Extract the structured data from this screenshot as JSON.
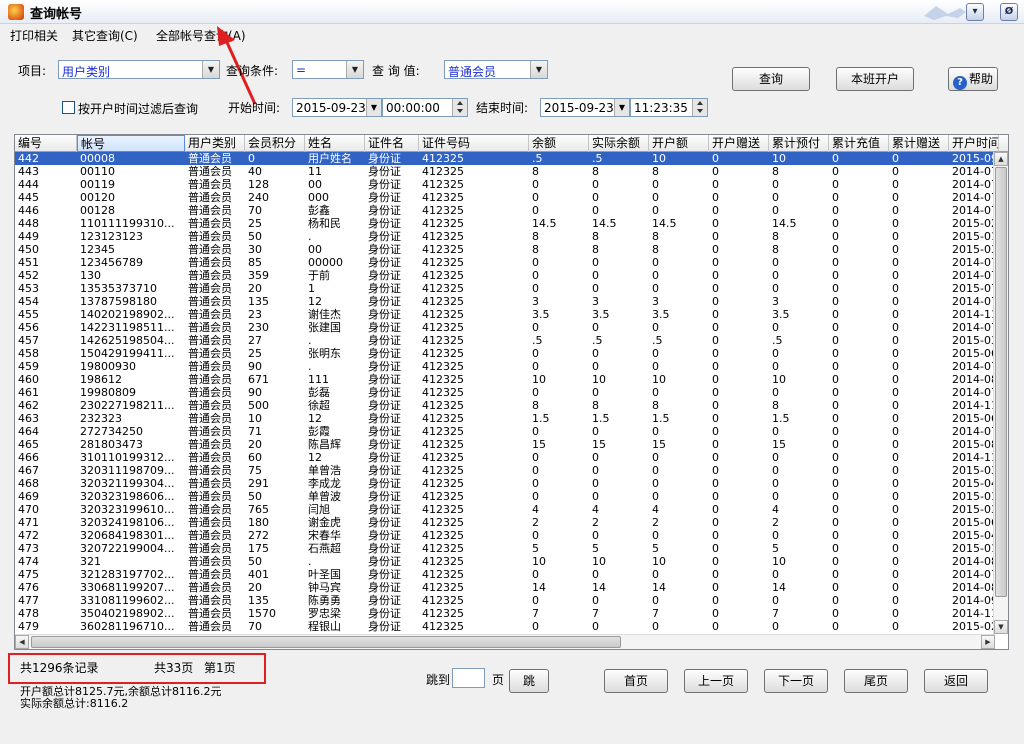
{
  "window": {
    "title": "查询帐号",
    "min_label": "▾",
    "close_label": "Ø"
  },
  "menu": {
    "items": [
      "打印相关",
      "其它查询(C)",
      "全部帐号查询(A)"
    ]
  },
  "filters": {
    "item_label": "项目:",
    "item_value": "用户类别",
    "condition_label": "查询条件:",
    "condition_value": "=",
    "query_value_label": "查 询 值:",
    "query_value": "普通会员",
    "filter_checkbox_label": "按开户时间过滤后查询",
    "start_label": "开始时间:",
    "start_date": "2015-09-23",
    "start_time": "00:00:00",
    "end_label": "结束时间:",
    "end_date": "2015-09-23",
    "end_time": "11:23:35"
  },
  "buttons": {
    "query": "查询",
    "open_account": "本班开户",
    "help": "帮助"
  },
  "table": {
    "columns": [
      "编号",
      "帐号",
      "用户类别",
      "会员积分",
      "姓名",
      "证件名",
      "证件号码",
      "余额",
      "实际余额",
      "开户额",
      "开户赠送",
      "累计预付",
      "累计充值",
      "累计赠送",
      "开户时间"
    ],
    "rows": [
      [
        "442",
        "00008",
        "普通会员",
        "0",
        "用户姓名",
        "身份证",
        "412325",
        ".5",
        ".5",
        "10",
        "0",
        "10",
        "0",
        "0",
        "2015-09"
      ],
      [
        "443",
        "00110",
        "普通会员",
        "40",
        "11",
        "身份证",
        "412325",
        "8",
        "8",
        "8",
        "0",
        "8",
        "0",
        "0",
        "2014-07"
      ],
      [
        "444",
        "00119",
        "普通会员",
        "128",
        "00",
        "身份证",
        "412325",
        "0",
        "0",
        "0",
        "0",
        "0",
        "0",
        "0",
        "2014-07"
      ],
      [
        "445",
        "00120",
        "普通会员",
        "240",
        "000",
        "身份证",
        "412325",
        "0",
        "0",
        "0",
        "0",
        "0",
        "0",
        "0",
        "2014-07"
      ],
      [
        "446",
        "00128",
        "普通会员",
        "70",
        "彭鑫",
        "身份证",
        "412325",
        "0",
        "0",
        "0",
        "0",
        "0",
        "0",
        "0",
        "2014-07"
      ],
      [
        "448",
        "110111199310...",
        "普通会员",
        "25",
        "杨和民",
        "身份证",
        "412325",
        "14.5",
        "14.5",
        "14.5",
        "0",
        "14.5",
        "0",
        "0",
        "2015-02"
      ],
      [
        "449",
        "123123123",
        "普通会员",
        "50",
        ".",
        "身份证",
        "412325",
        "8",
        "8",
        "8",
        "0",
        "8",
        "0",
        "0",
        "2015-01"
      ],
      [
        "450",
        "12345",
        "普通会员",
        "30",
        "00",
        "身份证",
        "412325",
        "8",
        "8",
        "8",
        "0",
        "8",
        "0",
        "0",
        "2015-03"
      ],
      [
        "451",
        "123456789",
        "普通会员",
        "85",
        "00000",
        "身份证",
        "412325",
        "0",
        "0",
        "0",
        "0",
        "0",
        "0",
        "0",
        "2014-07"
      ],
      [
        "452",
        "130",
        "普通会员",
        "359",
        "于前",
        "身份证",
        "412325",
        "0",
        "0",
        "0",
        "0",
        "0",
        "0",
        "0",
        "2014-07"
      ],
      [
        "453",
        "13535373710",
        "普通会员",
        "20",
        "1",
        "身份证",
        "412325",
        "0",
        "0",
        "0",
        "0",
        "0",
        "0",
        "0",
        "2015-07"
      ],
      [
        "454",
        "13787598180",
        "普通会员",
        "135",
        "12",
        "身份证",
        "412325",
        "3",
        "3",
        "3",
        "0",
        "3",
        "0",
        "0",
        "2014-07"
      ],
      [
        "455",
        "140202198902...",
        "普通会员",
        "23",
        "谢佳杰",
        "身份证",
        "412325",
        "3.5",
        "3.5",
        "3.5",
        "0",
        "3.5",
        "0",
        "0",
        "2014-11"
      ],
      [
        "456",
        "142231198511...",
        "普通会员",
        "230",
        "张建国",
        "身份证",
        "412325",
        "0",
        "0",
        "0",
        "0",
        "0",
        "0",
        "0",
        "2014-07"
      ],
      [
        "457",
        "142625198504...",
        "普通会员",
        "27",
        ".",
        "身份证",
        "412325",
        ".5",
        ".5",
        ".5",
        "0",
        ".5",
        "0",
        "0",
        "2015-03"
      ],
      [
        "458",
        "150429199411...",
        "普通会员",
        "25",
        "张明东",
        "身份证",
        "412325",
        "0",
        "0",
        "0",
        "0",
        "0",
        "0",
        "0",
        "2015-06"
      ],
      [
        "459",
        "19800930",
        "普通会员",
        "90",
        ".",
        "身份证",
        "412325",
        "0",
        "0",
        "0",
        "0",
        "0",
        "0",
        "0",
        "2014-07"
      ],
      [
        "460",
        "198612",
        "普通会员",
        "671",
        "111",
        "身份证",
        "412325",
        "10",
        "10",
        "10",
        "0",
        "10",
        "0",
        "0",
        "2014-08"
      ],
      [
        "461",
        "19980809",
        "普通会员",
        "90",
        "彭磊",
        "身份证",
        "412325",
        "0",
        "0",
        "0",
        "0",
        "0",
        "0",
        "0",
        "2014-07"
      ],
      [
        "462",
        "230227198211...",
        "普通会员",
        "500",
        "徐超",
        "身份证",
        "412325",
        "8",
        "8",
        "8",
        "0",
        "8",
        "0",
        "0",
        "2014-11"
      ],
      [
        "463",
        "232323",
        "普通会员",
        "10",
        "12",
        "身份证",
        "412325",
        "1.5",
        "1.5",
        "1.5",
        "0",
        "1.5",
        "0",
        "0",
        "2015-06"
      ],
      [
        "464",
        "272734250",
        "普通会员",
        "71",
        "彭霞",
        "身份证",
        "412325",
        "0",
        "0",
        "0",
        "0",
        "0",
        "0",
        "0",
        "2014-07"
      ],
      [
        "465",
        "281803473",
        "普通会员",
        "20",
        "陈昌辉",
        "身份证",
        "412325",
        "15",
        "15",
        "15",
        "0",
        "15",
        "0",
        "0",
        "2015-08"
      ],
      [
        "466",
        "310110199312...",
        "普通会员",
        "60",
        "12",
        "身份证",
        "412325",
        "0",
        "0",
        "0",
        "0",
        "0",
        "0",
        "0",
        "2014-11"
      ],
      [
        "467",
        "320311198709...",
        "普通会员",
        "75",
        "单曾浩",
        "身份证",
        "412325",
        "0",
        "0",
        "0",
        "0",
        "0",
        "0",
        "0",
        "2015-03"
      ],
      [
        "468",
        "320321199304...",
        "普通会员",
        "291",
        "李成龙",
        "身份证",
        "412325",
        "0",
        "0",
        "0",
        "0",
        "0",
        "0",
        "0",
        "2015-04"
      ],
      [
        "469",
        "320323198606...",
        "普通会员",
        "50",
        "单曾波",
        "身份证",
        "412325",
        "0",
        "0",
        "0",
        "0",
        "0",
        "0",
        "0",
        "2015-01"
      ],
      [
        "470",
        "320323199610...",
        "普通会员",
        "765",
        "闫旭",
        "身份证",
        "412325",
        "4",
        "4",
        "4",
        "0",
        "4",
        "0",
        "0",
        "2015-03"
      ],
      [
        "471",
        "320324198106...",
        "普通会员",
        "180",
        "谢金虎",
        "身份证",
        "412325",
        "2",
        "2",
        "2",
        "0",
        "2",
        "0",
        "0",
        "2015-06"
      ],
      [
        "472",
        "320684198301...",
        "普通会员",
        "272",
        "宋春华",
        "身份证",
        "412325",
        "0",
        "0",
        "0",
        "0",
        "0",
        "0",
        "0",
        "2015-04"
      ],
      [
        "473",
        "320722199004...",
        "普通会员",
        "175",
        "石燕超",
        "身份证",
        "412325",
        "5",
        "5",
        "5",
        "0",
        "5",
        "0",
        "0",
        "2015-01"
      ],
      [
        "474",
        "321",
        "普通会员",
        "50",
        ".",
        "身份证",
        "412325",
        "10",
        "10",
        "10",
        "0",
        "10",
        "0",
        "0",
        "2014-08"
      ],
      [
        "475",
        "321283197702...",
        "普通会员",
        "401",
        "叶圣国",
        "身份证",
        "412325",
        "0",
        "0",
        "0",
        "0",
        "0",
        "0",
        "0",
        "2014-07"
      ],
      [
        "476",
        "330681199207...",
        "普通会员",
        "20",
        "钟马宾",
        "身份证",
        "412325",
        "14",
        "14",
        "14",
        "0",
        "14",
        "0",
        "0",
        "2014-08"
      ],
      [
        "477",
        "331081199602...",
        "普通会员",
        "135",
        "陈勇勇",
        "身份证",
        "412325",
        "0",
        "0",
        "0",
        "0",
        "0",
        "0",
        "0",
        "2014-09"
      ],
      [
        "478",
        "350402198902...",
        "普通会员",
        "1570",
        "罗忠梁",
        "身份证",
        "412325",
        "7",
        "7",
        "7",
        "0",
        "7",
        "0",
        "0",
        "2014-11"
      ],
      [
        "479",
        "360281196710...",
        "普通会员",
        "70",
        "程银山",
        "身份证",
        "412325",
        "0",
        "0",
        "0",
        "0",
        "0",
        "0",
        "0",
        "2015-02"
      ]
    ]
  },
  "footer": {
    "records": "共1296条记录",
    "pages": "共33页",
    "current": "第1页",
    "goto_label": "跳到",
    "page_unit": "页",
    "goto_button": "跳",
    "first": "首页",
    "prev": "上一页",
    "next": "下一页",
    "last": "尾页",
    "back": "返回",
    "total1": "开户额总计8125.7元,余额总计8116.2元",
    "total2": "实际余额总计:8116.2"
  },
  "colors": {
    "selected_row": "#3163c5",
    "annotation_red": "#e02020",
    "link_blue": "#1a2fd6"
  }
}
